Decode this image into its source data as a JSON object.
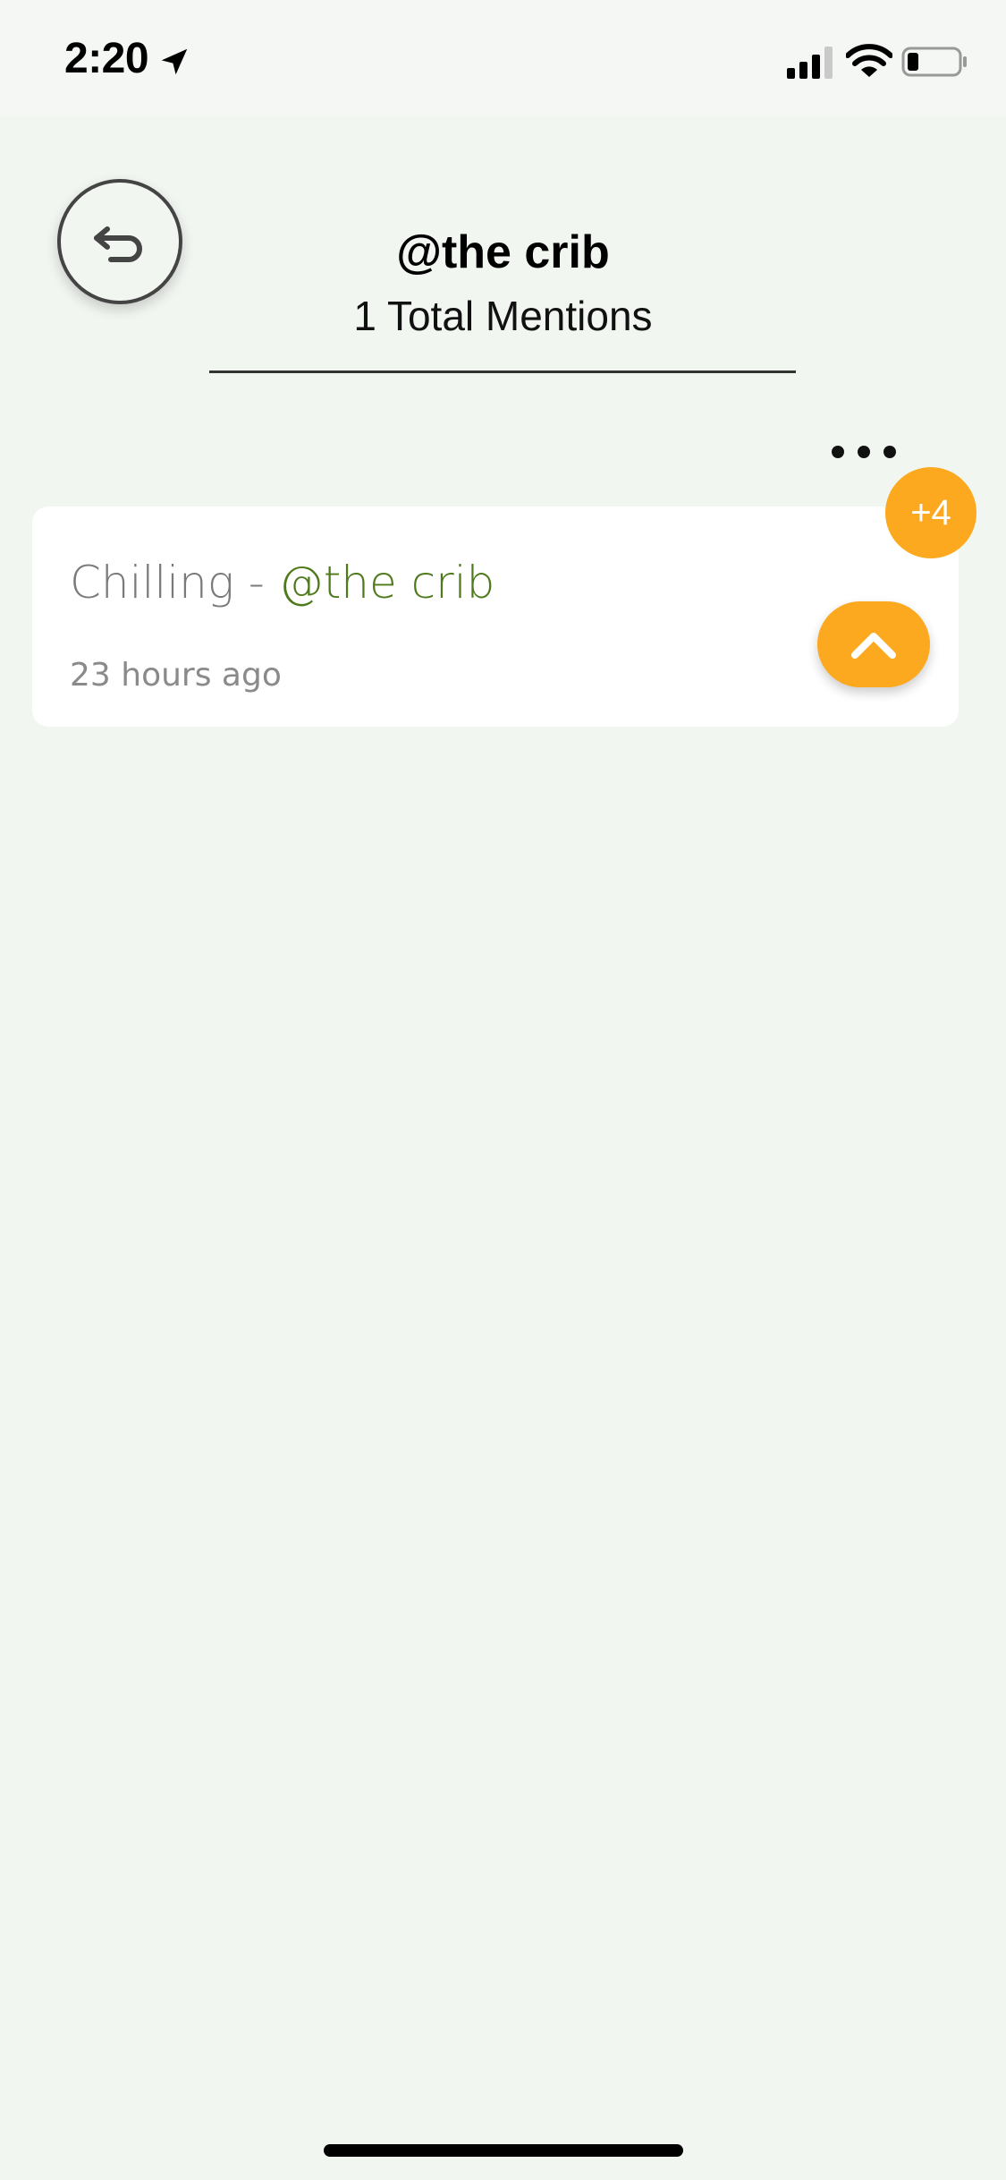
{
  "status_bar": {
    "time": "2:20"
  },
  "header": {
    "title": "@the crib",
    "subtitle": "1 Total Mentions"
  },
  "mentions": [
    {
      "text": "Chilling - ",
      "tag": "@the crib",
      "time_ago": "23 hours ago",
      "vote_badge": "+4"
    }
  ],
  "colors": {
    "accent": "#fca91f",
    "tag_green": "#4f7a1b",
    "background": "#f2f6f1"
  }
}
